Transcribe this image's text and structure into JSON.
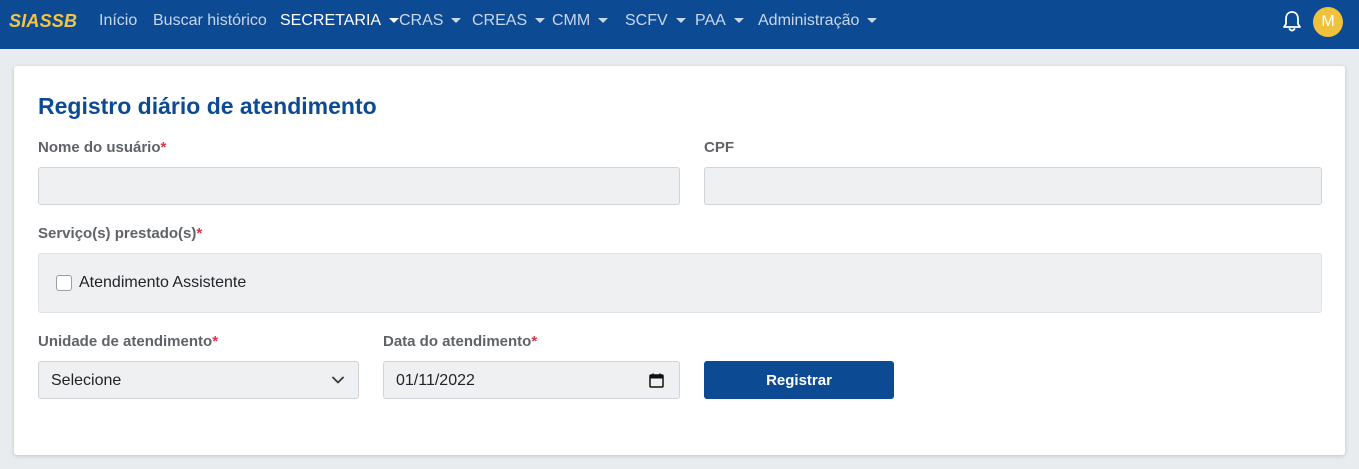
{
  "navbar": {
    "brand": "SIASSB",
    "items": [
      {
        "label": "Início",
        "dropdown": false,
        "active": false
      },
      {
        "label": "Buscar histórico",
        "dropdown": false,
        "active": false
      },
      {
        "label": "SECRETARIA",
        "dropdown": true,
        "active": true
      },
      {
        "label": "CRAS",
        "dropdown": true,
        "active": false
      },
      {
        "label": "CREAS",
        "dropdown": true,
        "active": false
      },
      {
        "label": "CMM",
        "dropdown": true,
        "active": false
      },
      {
        "label": "SCFV",
        "dropdown": true,
        "active": false
      },
      {
        "label": "PAA",
        "dropdown": true,
        "active": false
      },
      {
        "label": "Administração",
        "dropdown": true,
        "active": false
      }
    ],
    "notification_icon": "bell-icon",
    "avatar_initial": "M"
  },
  "form": {
    "title": "Registro diário de atendimento",
    "user_name": {
      "label": "Nome do usuário",
      "required_mark": "*",
      "value": ""
    },
    "cpf": {
      "label": "CPF",
      "value": ""
    },
    "services": {
      "label": "Serviço(s) prestado(s)",
      "required_mark": "*",
      "options": [
        {
          "label": "Atendimento Assistente",
          "checked": false
        }
      ]
    },
    "unit": {
      "label": "Unidade de atendimento",
      "required_mark": "*",
      "selected": "Selecione"
    },
    "date": {
      "label": "Data do atendimento",
      "required_mark": "*",
      "value": "01/11/2022"
    },
    "submit_label": "Registrar"
  },
  "colors": {
    "navbar_bg": "#0d4a94",
    "brand": "#f5c542",
    "avatar_bg": "#f0c23b",
    "title": "#0d4a94",
    "required": "#dc3545",
    "button_bg": "#0d4a94"
  }
}
